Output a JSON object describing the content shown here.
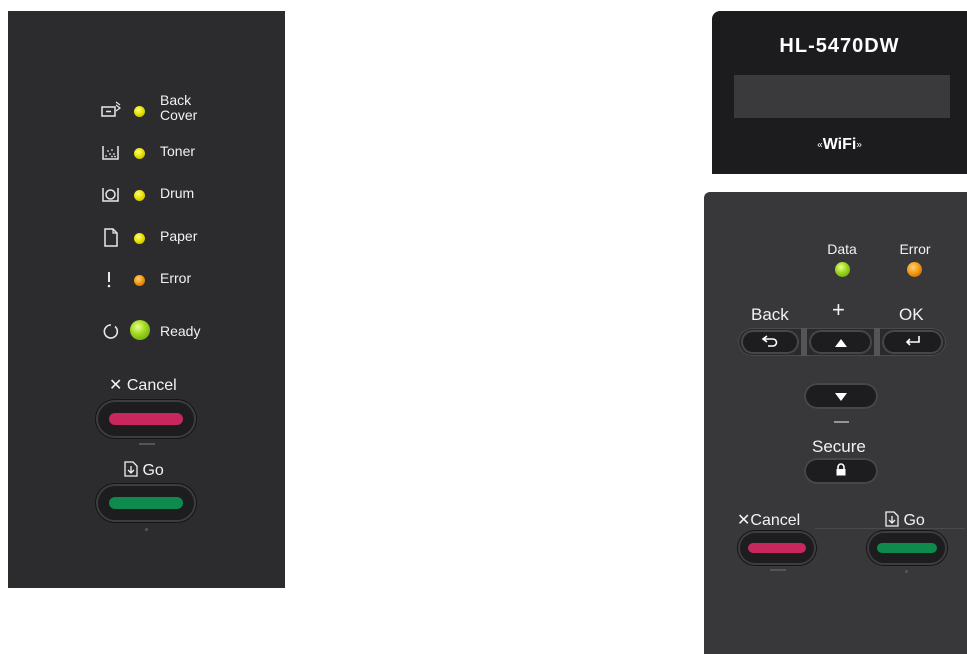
{
  "left_panel": {
    "statuses": [
      {
        "label_line1": "Back",
        "label_line2": "Cover",
        "icon": "back-cover-icon",
        "led_color": "yellow"
      },
      {
        "label": "Toner",
        "icon": "toner-icon",
        "led_color": "yellow"
      },
      {
        "label": "Drum",
        "icon": "drum-icon",
        "led_color": "yellow"
      },
      {
        "label": "Paper",
        "icon": "paper-icon",
        "led_color": "yellow"
      },
      {
        "label": "Error",
        "icon": "exclamation-icon",
        "led_color": "orange"
      },
      {
        "label": "Ready",
        "icon": "power-icon",
        "led_color": "green"
      }
    ],
    "cancel_label": "Cancel",
    "go_label": "Go"
  },
  "display_panel": {
    "model": "HL-5470DW",
    "wifi_text": "WiFi",
    "wifi_wave_left": "«",
    "wifi_wave_right": "»"
  },
  "control_panel": {
    "data_label": "Data",
    "error_label": "Error",
    "back_label": "Back",
    "plus_label": "+",
    "ok_label": "OK",
    "minus_label": "—",
    "secure_label": "Secure",
    "cancel_label": "Cancel",
    "go_label": "Go",
    "colors": {
      "cancel_bar": "#c8275d",
      "go_bar": "#0e8a4c",
      "data_led": "#9bd51a",
      "error_led": "#f39c12"
    }
  }
}
